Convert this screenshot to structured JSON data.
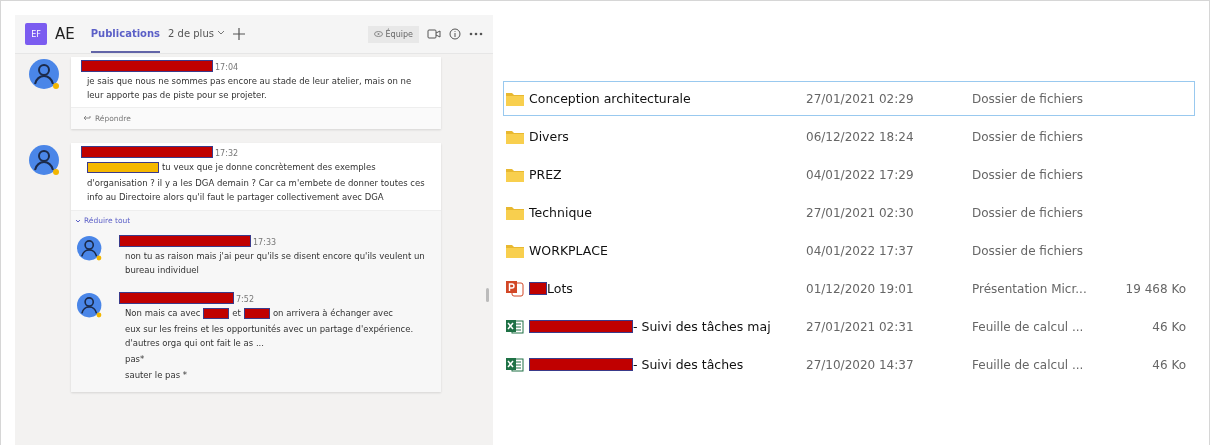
{
  "header": {
    "team_initials": "EF",
    "team_name": "AE",
    "tabs": [
      {
        "label": "Publications",
        "selected": true
      },
      {
        "label": "2 de plus",
        "selected": false
      }
    ],
    "team_button": "Équipe"
  },
  "threads": [
    {
      "time": "17:04",
      "body": [
        [
          {
            "kind": "text",
            "text": "je sais que nous ne sommes pas encore au stade de leur atelier, mais on ne leur apporte pas de piste pour se projeter."
          }
        ]
      ],
      "reply_label": "Répondre"
    },
    {
      "time": "17:32",
      "body": [
        [
          {
            "kind": "redaction",
            "color": "#f5b800"
          },
          {
            "kind": "text",
            "text": "tu veux que je donne concrètement des exemples"
          }
        ],
        [
          {
            "kind": "text",
            "text": "d'organisation ? il y a les DGA demain ? Car ca m'embete de donner toutes ces info au Directoire alors qu'il faut le partager collectivement avec DGA"
          }
        ]
      ],
      "collapse_label": "Réduire tout",
      "children": [
        {
          "time": "17:33",
          "body": [
            [
              {
                "kind": "text",
                "text": "non tu as raison mais j'ai peur qu'ils se disent encore qu'ils veulent un bureau individuel"
              }
            ]
          ]
        },
        {
          "time": "7:52",
          "body": [
            [
              {
                "kind": "text",
                "text": "Non mais ca avec"
              },
              {
                "kind": "redaction",
                "color": "#c00000"
              },
              {
                "kind": "text",
                "text": "et"
              },
              {
                "kind": "redaction",
                "color": "#c00000"
              },
              {
                "kind": "text",
                "text": "on arrivera à échanger avec"
              }
            ],
            [
              {
                "kind": "text",
                "text": "eux sur les freins et les opportunités avec un partage d'expérience. d'autres orga qui ont fait le as ..."
              }
            ],
            [
              {
                "kind": "text",
                "text": "pas*"
              }
            ],
            [
              {
                "kind": "text",
                "text": "sauter le pas *"
              }
            ]
          ]
        }
      ]
    }
  ],
  "files": [
    {
      "kind": "folder",
      "name": "Conception architecturale",
      "redacted": false,
      "date": "27/01/2021 02:29",
      "type": "Dossier de fichiers",
      "selected": true
    },
    {
      "kind": "folder",
      "name": "Divers",
      "redacted": false,
      "date": "06/12/2022 18:24",
      "type": "Dossier de fichiers",
      "selected": false
    },
    {
      "kind": "folder",
      "name": "PREZ",
      "redacted": false,
      "date": "04/01/2022 17:29",
      "type": "Dossier de fichiers",
      "selected": false
    },
    {
      "kind": "folder",
      "name": "Technique",
      "redacted": false,
      "date": "27/01/2021 02:30",
      "type": "Dossier de fichiers",
      "selected": false
    },
    {
      "kind": "folder",
      "name": "WORKPLACE",
      "redacted": false,
      "date": "04/01/2022 17:37",
      "type": "Dossier de fichiers",
      "selected": false
    },
    {
      "kind": "powerpoint",
      "name": "Lots",
      "redacted": true,
      "date": "01/12/2020 19:01",
      "type": "Présentation Micr...",
      "size": "19 468 Ko",
      "selected": false
    },
    {
      "kind": "excel",
      "name": "- Suivi des tâches maj",
      "redacted": true,
      "date": "27/01/2021 02:31",
      "type": "Feuille de calcul ...",
      "size": "46 Ko",
      "selected": false
    },
    {
      "kind": "excel",
      "name": "- Suivi des tâches",
      "redacted": true,
      "date": "27/10/2020 14:37",
      "type": "Feuille de calcul ...",
      "size": "46 Ko",
      "selected": false
    }
  ]
}
